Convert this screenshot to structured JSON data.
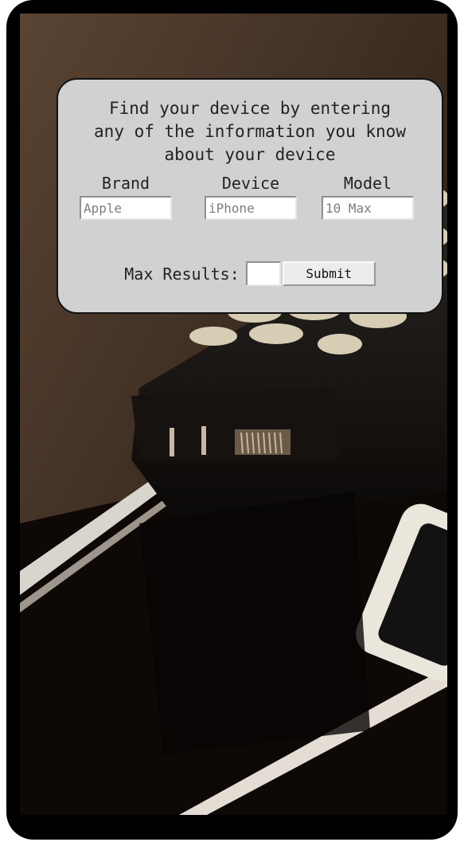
{
  "search_form": {
    "intro": "Find your device by entering\nany of the information you know\nabout your device",
    "fields": [
      {
        "label": "Brand",
        "placeholder": "Apple"
      },
      {
        "label": "Device",
        "placeholder": "iPhone"
      },
      {
        "label": "Model",
        "placeholder": "10 Max"
      }
    ],
    "max_results_label": "Max Results:",
    "max_results_value": "",
    "submit_label": "Submit"
  },
  "colors": {
    "card_background": "#d1d1d1",
    "frame": "#000000",
    "text": "#222222"
  }
}
